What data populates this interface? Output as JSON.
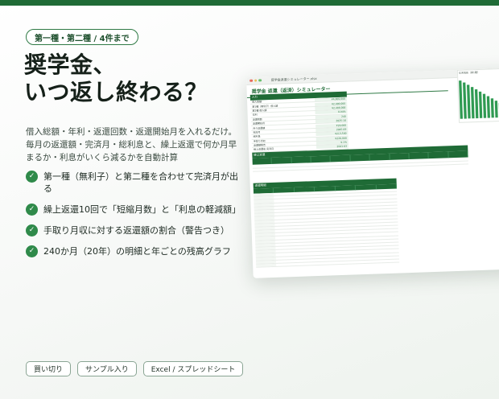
{
  "tag": "第一種・第二種 / 4件まで",
  "title_line1": "奨学金、",
  "title_line2": "いつ返し終わる？",
  "description": "借入総額・年利・返還回数・返還開始月を入れるだけ。毎月の返還額・完済月・総利息と、繰上返還で何か月早まるか・利息がいくら減るかを自動計算",
  "features": [
    "第一種（無利子）と第二種を合わせて完済月が出る",
    "繰上返還10回で「短縮月数」と「利息の軽減額」",
    "手取り月収に対する返還額の割合（警告つき）",
    "240か月（20年）の明細と年ごとの残高グラフ"
  ],
  "badges": [
    "買い切り",
    "サンプル入り",
    "Excel / スプレッドシート"
  ],
  "check_glyph": "✓",
  "colors": {
    "accent": "#1f6b36",
    "check": "#2f8a4a"
  },
  "mockup": {
    "window_title": "奨学金返還シミュレーター.xlsx",
    "sheet_title": "奨学金 返還（返済）シミュレーター",
    "input_section": "入力",
    "input_rows": [
      [
        "借入総額",
        "¥4,800,000"
      ],
      [
        "第1種（無利子）借入額",
        "¥2,400,000"
      ],
      [
        "第2種 借入額",
        "¥2,400,000"
      ],
      [
        "年利",
        "0.94%"
      ],
      [
        "返還回数",
        "240"
      ],
      [
        "返還開始月",
        "2025-10"
      ],
      [
        "月々返還額",
        "¥20,000"
      ],
      [
        "完済月",
        "2045-09"
      ],
      [
        "総利息",
        "¥213,500"
      ],
      [
        "手取り月収",
        "¥220,000"
      ],
      [
        "返還額割合",
        "9.1%"
      ],
      [
        "繰上返還後 完済月",
        "2041-03"
      ],
      [
        "利息軽減額",
        "¥48,300"
      ]
    ],
    "chart_title": "年末残高（第1種）",
    "chart_bars": [
      0.95,
      0.9,
      0.84,
      0.78,
      0.72,
      0.66,
      0.6,
      0.54,
      0.48,
      0.42,
      0.36,
      0.3,
      0.24,
      0.18
    ],
    "section2": "繰上返還",
    "section3": "返還明細"
  }
}
